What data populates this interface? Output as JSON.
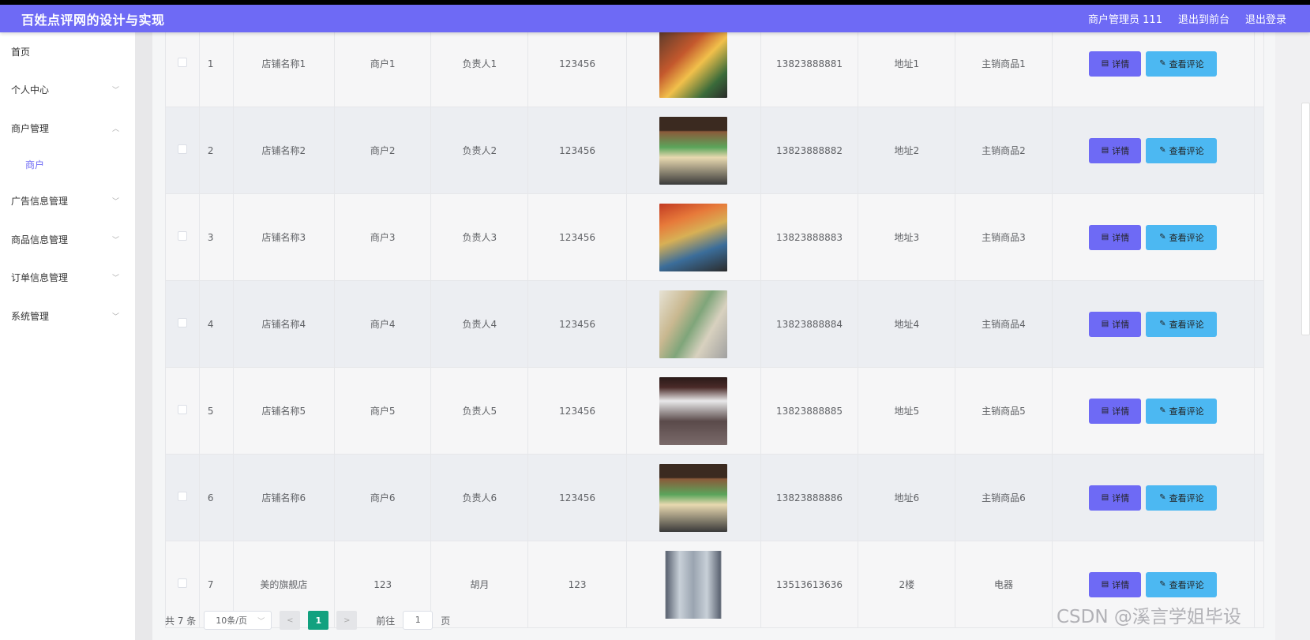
{
  "header": {
    "title": "百姓点评网的设计与实现",
    "user": "商户管理员 111",
    "to_front": "退出到前台",
    "logout": "退出登录"
  },
  "sidebar": {
    "items": [
      {
        "label": "首页",
        "chevron": ""
      },
      {
        "label": "个人中心",
        "chevron": "﹀"
      },
      {
        "label": "商户管理",
        "chevron": "︿"
      },
      {
        "label": "商户",
        "chevron": ""
      },
      {
        "label": "广告信息管理",
        "chevron": "﹀"
      },
      {
        "label": "商品信息管理",
        "chevron": "﹀"
      },
      {
        "label": "订单信息管理",
        "chevron": "﹀"
      },
      {
        "label": "系统管理",
        "chevron": "﹀"
      }
    ]
  },
  "table": {
    "detail_label": "详情",
    "review_label": "查看评论",
    "rows": [
      {
        "idx": "1",
        "shop": "店铺名称1",
        "merchant": "商户1",
        "contact": "负责人1",
        "pwd": "123456",
        "phone": "13823888881",
        "addr": "地址1",
        "goods": "主销商品1"
      },
      {
        "idx": "2",
        "shop": "店铺名称2",
        "merchant": "商户2",
        "contact": "负责人2",
        "pwd": "123456",
        "phone": "13823888882",
        "addr": "地址2",
        "goods": "主销商品2"
      },
      {
        "idx": "3",
        "shop": "店铺名称3",
        "merchant": "商户3",
        "contact": "负责人3",
        "pwd": "123456",
        "phone": "13823888883",
        "addr": "地址3",
        "goods": "主销商品3"
      },
      {
        "idx": "4",
        "shop": "店铺名称4",
        "merchant": "商户4",
        "contact": "负责人4",
        "pwd": "123456",
        "phone": "13823888884",
        "addr": "地址4",
        "goods": "主销商品4"
      },
      {
        "idx": "5",
        "shop": "店铺名称5",
        "merchant": "商户5",
        "contact": "负责人5",
        "pwd": "123456",
        "phone": "13823888885",
        "addr": "地址5",
        "goods": "主销商品5"
      },
      {
        "idx": "6",
        "shop": "店铺名称6",
        "merchant": "商户6",
        "contact": "负责人6",
        "pwd": "123456",
        "phone": "13823888886",
        "addr": "地址6",
        "goods": "主销商品6"
      },
      {
        "idx": "7",
        "shop": "美的旗舰店",
        "merchant": "123",
        "contact": "胡月",
        "pwd": "123",
        "phone": "13513613636",
        "addr": "2楼",
        "goods": "电器"
      }
    ]
  },
  "pager": {
    "total": "共 7 条",
    "page_size": "10条/页",
    "current": "1",
    "goto_prefix": "前往",
    "goto_value": "1",
    "goto_suffix": "页"
  },
  "watermark": "CSDN @溪言学姐毕设",
  "colors": {
    "header_bg": "#6e6af5",
    "detail_btn": "#6e6af5",
    "review_btn": "#4cb8f2",
    "pager_active": "#12a17f"
  }
}
